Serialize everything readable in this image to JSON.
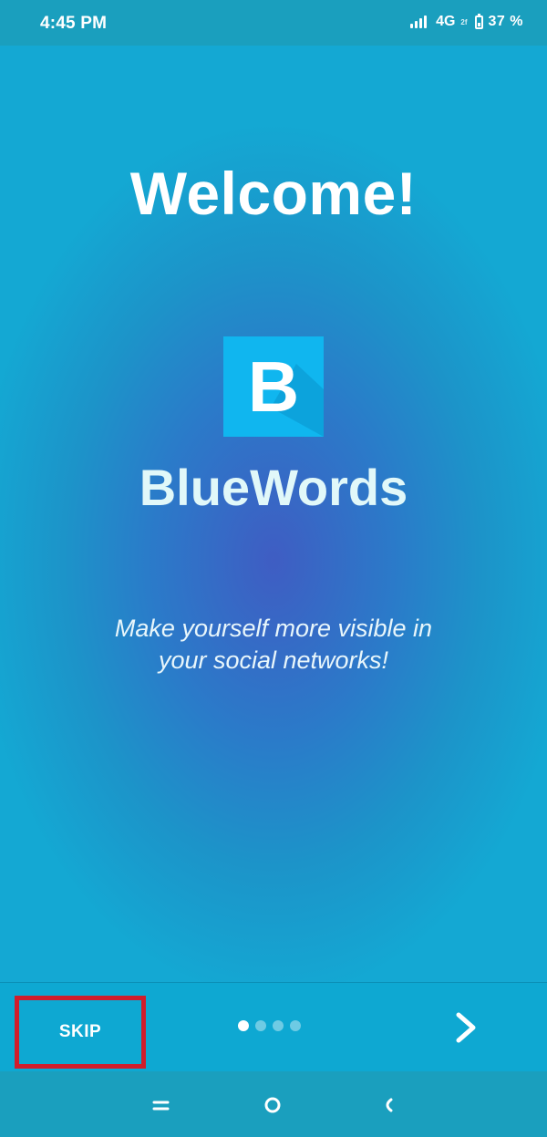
{
  "status_bar": {
    "time": "4:45 PM",
    "network": "4G",
    "network_sub": "2f",
    "battery_percent": "37 %",
    "icons": [
      "signal-icon",
      "battery-icon"
    ]
  },
  "onboarding": {
    "welcome_title": "Welcome!",
    "logo_letter": "B",
    "app_name": "BlueWords",
    "tagline_line1": "Make yourself more visible in",
    "tagline_line2": "your social networks!",
    "skip_label": "SKIP",
    "page_count": 4,
    "current_page": 1,
    "next_icon": "chevron-right-icon"
  },
  "nav_bar": {
    "buttons": [
      "menu-icon",
      "home-icon",
      "back-icon"
    ]
  },
  "colors": {
    "status_bar": "#1a9fbe",
    "logo_bg": "#10b6ef",
    "highlight_border": "#d11d2b",
    "app_name_text": "#e1f8f9"
  }
}
